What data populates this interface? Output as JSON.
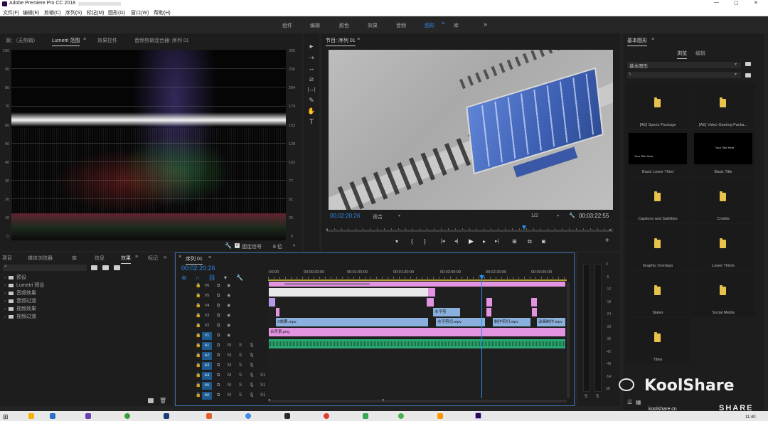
{
  "window": {
    "title": "Adobe Premiere Pro CC 2018",
    "title_suffix": " - ",
    "controls": [
      "—",
      "▢",
      "✕"
    ]
  },
  "menu": [
    "文件(F)",
    "编辑(E)",
    "剪辑(C)",
    "序列(S)",
    "标记(M)",
    "图形(G)",
    "窗口(W)",
    "帮助(H)"
  ],
  "workspaces": {
    "items": [
      "组件",
      "编辑",
      "颜色",
      "效果",
      "音频",
      "图形",
      "库"
    ],
    "active_index": 5,
    "overflow": "»",
    "active_menu": "≡"
  },
  "scopes_panel": {
    "tabs": [
      "源：（无剪辑）",
      "Lumetri 范围",
      "效果控件",
      "音频剪辑混合器: 序列 01"
    ],
    "active_tab": 1,
    "left_scale": [
      "100",
      "90",
      "80",
      "70",
      "60",
      "50",
      "40",
      "30",
      "20",
      "10",
      "0"
    ],
    "right_scale": [
      "255",
      "230",
      "204",
      "179",
      "153",
      "128",
      "102",
      "77",
      "51",
      "26",
      "0"
    ],
    "clamp_label": "固定信号",
    "clamp_checked": true,
    "bit_depth": "8 位"
  },
  "program_monitor": {
    "title": "节目: 序列 01",
    "current_time": "00:02:20:26",
    "fit": "适合",
    "resolution": "1/2",
    "duration": "00:03:22:55",
    "transport_icons": [
      "▾",
      "{",
      "}",
      "|◂",
      "◂|",
      "◂",
      "▶",
      "▸",
      "▸|",
      "⊞",
      "⧉",
      "◙",
      "+"
    ]
  },
  "tools": [
    "▸",
    "⇢",
    "↔",
    "⧄",
    "|↔|",
    "✎",
    "✋",
    "T"
  ],
  "graphics_panel": {
    "title": "基本图形",
    "tabs": [
      "浏览",
      "编辑"
    ],
    "active_tab": 0,
    "dropdown": "基本图形",
    "path": "\\",
    "items": [
      {
        "label": "[AE] Sports Package",
        "kind": "folder"
      },
      {
        "label": "[AE] Video Gaming Packa...",
        "kind": "folder"
      },
      {
        "label": "Basic Lower Third",
        "kind": "thumb",
        "thumb_text": "Your Title Here"
      },
      {
        "label": "Basic Title",
        "kind": "thumb",
        "thumb_text": "Your Title Here"
      },
      {
        "label": "Captions and Subtitles",
        "kind": "folder"
      },
      {
        "label": "Credits",
        "kind": "folder"
      },
      {
        "label": "Graphic Overlays",
        "kind": "folder"
      },
      {
        "label": "Lower Thirds",
        "kind": "folder"
      },
      {
        "label": "Slates",
        "kind": "folder"
      },
      {
        "label": "Social Media",
        "kind": "folder"
      },
      {
        "label": "Titles",
        "kind": "folder"
      }
    ]
  },
  "effects_panel": {
    "tabs": [
      "项目",
      "媒体浏览器",
      "库",
      "信息",
      "效果",
      "标记"
    ],
    "active_tab": 4,
    "search_placeholder": "",
    "tree": [
      "预设",
      "Lumetri 预设",
      "音频效果",
      "音频过渡",
      "视频效果",
      "视频过渡"
    ]
  },
  "timeline": {
    "title": "序列 01",
    "timecode": "00:02:20:26",
    "ruler": [
      ":00:00",
      "00:00:30:00",
      "00:01:00:00",
      "00:01:30:00",
      "00:02:00:00",
      "00:02:30:00",
      "00:03:00:00"
    ],
    "video_tracks": [
      "V6",
      "V5",
      "V4",
      "V3",
      "V2",
      "V1"
    ],
    "audio_tracks": [
      "A1",
      "A2",
      "A3",
      "A4",
      "A5",
      "A6"
    ],
    "toggles_m": "M",
    "toggles_s": "S",
    "mix_label": "S1",
    "clips": {
      "v5_label": "",
      "v2_a": "X效果.mpv",
      "v2_b": "水平剪切.mpv",
      "v2_c": "制作剪切.mpv",
      "v2_d": "动画制作.mpv",
      "v3_a": "水平剪",
      "v1": "合背景.png",
      "v6_tail": "",
      "a1": ""
    }
  },
  "audio_meter": {
    "scale": [
      "0",
      "-6",
      "-12",
      "-18",
      "-24",
      "-30",
      "-36",
      "-42",
      "-48",
      "-54",
      "dB"
    ],
    "footer": [
      "S",
      "S"
    ]
  },
  "watermark": {
    "brand": "KoolShare",
    "sub": "SHARE",
    "site": "koolshare.cn"
  },
  "taskbar": {
    "time": "11:40"
  },
  "colors": {
    "accent": "#2d8ceb",
    "clip_pink": "#e294e0",
    "clip_blue": "#8ab0dd",
    "audio_green": "#2aa873",
    "folder": "#e8c24a"
  }
}
